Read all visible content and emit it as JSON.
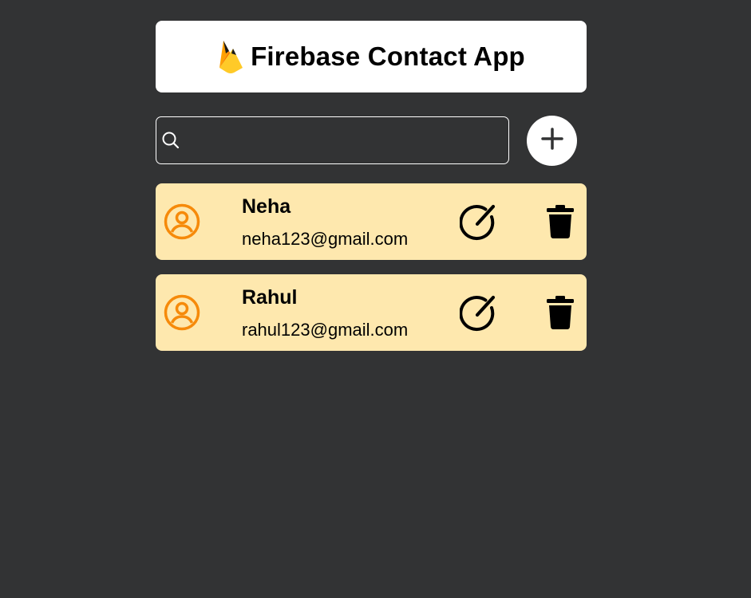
{
  "app": {
    "title": "Firebase Contact App",
    "logo_icon": "firebase-flame-icon"
  },
  "search": {
    "value": "",
    "placeholder": "",
    "icon": "search-icon"
  },
  "add_button": {
    "icon": "plus-icon"
  },
  "contacts": [
    {
      "name": "Neha",
      "email": "neha123@gmail.com"
    },
    {
      "name": "Rahul",
      "email": "rahul123@gmail.com"
    }
  ],
  "colors": {
    "background": "#323334",
    "card": "#fee8ae",
    "avatar_accent": "#f68a0a",
    "header": "#ffffff"
  },
  "icons": {
    "avatar": "user-circle-icon",
    "edit": "edit-icon",
    "delete": "trash-icon"
  }
}
